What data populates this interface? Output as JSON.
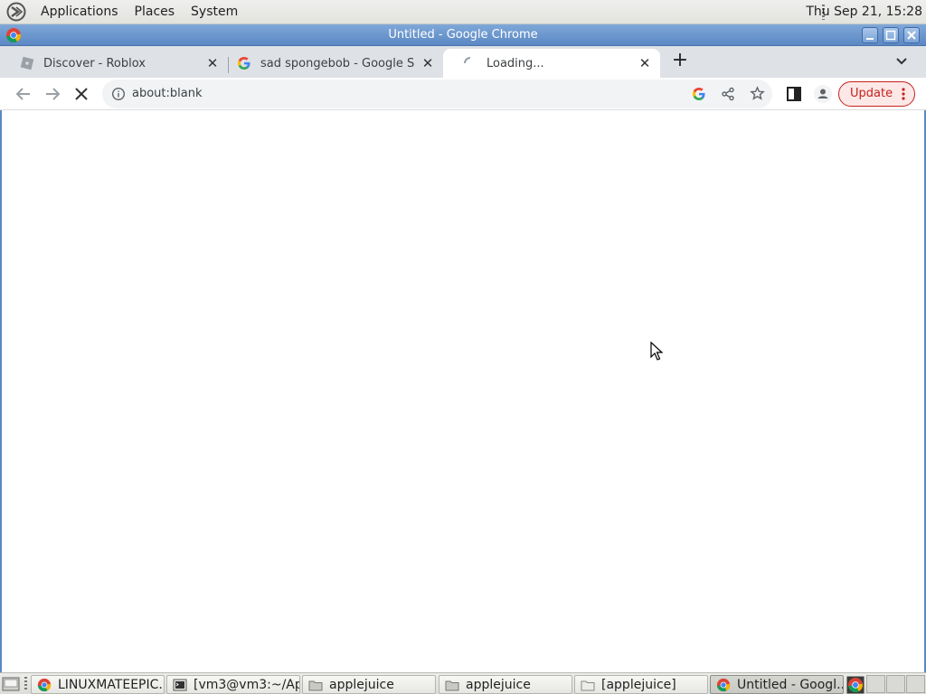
{
  "top_panel": {
    "menus": [
      "Applications",
      "Places",
      "System"
    ],
    "clock": "Thu Sep 21, 15:28"
  },
  "window": {
    "title": "Untitled - Google Chrome",
    "controls": [
      "minimize",
      "maximize",
      "close"
    ]
  },
  "tabs": [
    {
      "label": "Discover - Roblox",
      "icon": "roblox-icon",
      "active": false
    },
    {
      "label": "sad spongebob - Google Search",
      "icon": "google-icon",
      "active": false
    },
    {
      "label": "Loading...",
      "icon": "loading-spinner-icon",
      "active": true
    }
  ],
  "toolbar": {
    "url": "about:blank",
    "update_label": "Update"
  },
  "taskbar": {
    "items": [
      {
        "label": "LINUXMATEEPIC...",
        "icon": "chrome-icon",
        "active": false
      },
      {
        "label": "[vm3@vm3:~/Ap...",
        "icon": "terminal-icon",
        "active": false
      },
      {
        "label": "applejuice",
        "icon": "folder-icon",
        "active": false
      },
      {
        "label": "applejuice",
        "icon": "folder-icon",
        "active": false
      },
      {
        "label": "[applejuice]",
        "icon": "folder-icon",
        "active": false
      },
      {
        "label": "Untitled - Googl...",
        "icon": "chrome-icon",
        "active": true
      }
    ]
  },
  "colors": {
    "titlebar": "#5b88c4",
    "tab_strip": "#dee1e6",
    "update_accent": "#c5221f",
    "google_blue": "#4285f4",
    "google_red": "#ea4335",
    "google_yellow": "#fbbc05",
    "google_green": "#34a853"
  }
}
